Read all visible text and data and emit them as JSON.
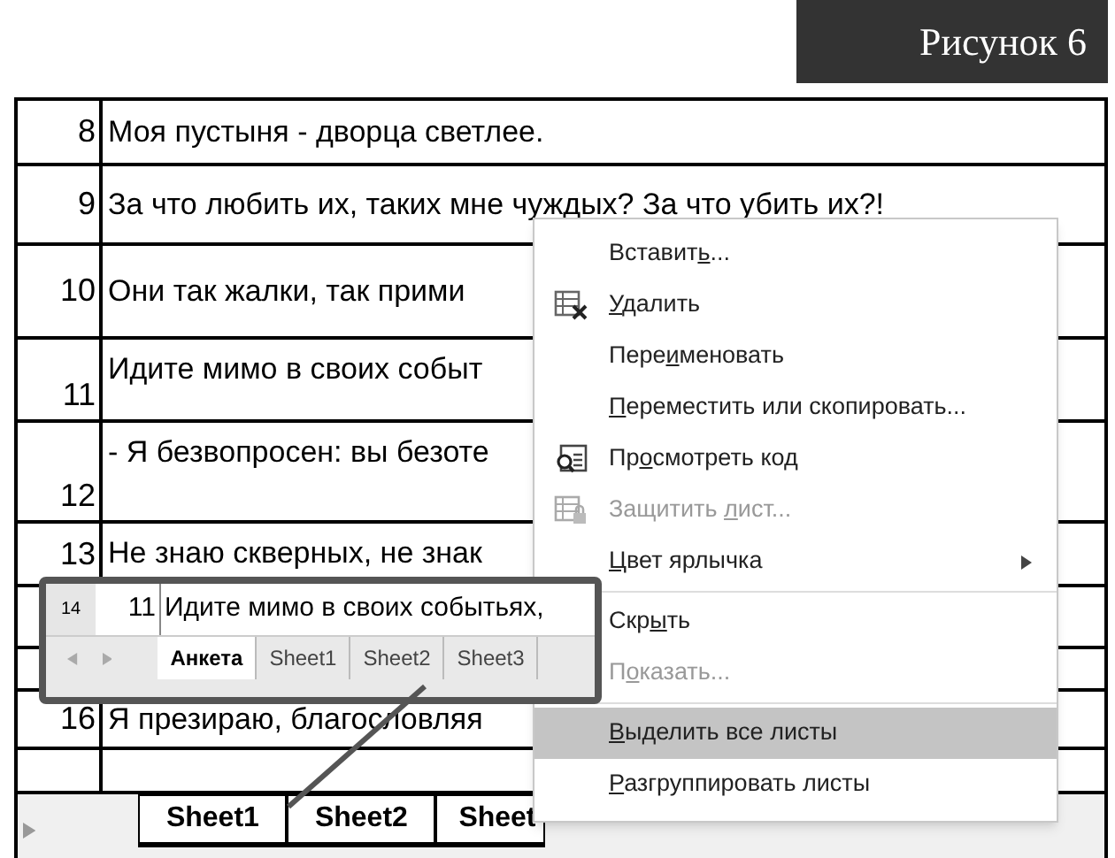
{
  "caption": "Рисунок 6",
  "rows": [
    {
      "number": "8",
      "text": "Моя пустыня - дворца светлее.",
      "kind": "plain"
    },
    {
      "number": "9",
      "text": "За что любить их, таких мне чуждых? За что убить их?!",
      "kind": "plain"
    },
    {
      "number": "10",
      "text": "Они так жалки, так прими",
      "kind": "plain"
    },
    {
      "number": "11",
      "text": "Идите мимо в своих событ",
      "kind": "wrapped"
    },
    {
      "number": "12",
      "text": "- Я безвопросен: вы безоте",
      "kind": "wrapped"
    },
    {
      "number": "13",
      "text": "Не знаю скверных, не знак",
      "kind": "plain"
    },
    {
      "kind": "plain"
    },
    {
      "kind": "plain"
    },
    {
      "number": "16",
      "text": "Я презираю, благословляя",
      "kind": "plain"
    },
    {
      "kind": "plain"
    }
  ],
  "sheet_tabs": [
    {
      "label": "Sheet1",
      "selected": true
    },
    {
      "label": "Sheet2",
      "selected": true
    },
    {
      "label": "Sheet",
      "selected": true
    }
  ],
  "inset": {
    "row_header": "14",
    "number": "11",
    "text": "Идите мимо в своих событьях,",
    "tabs": [
      {
        "label": "Анкета",
        "selected": true
      },
      {
        "label": "Sheet1",
        "selected": false
      },
      {
        "label": "Sheet2",
        "selected": false
      },
      {
        "label": "Sheet3",
        "selected": false
      }
    ]
  },
  "context_menu": [
    {
      "label": [
        {
          "text": "Вставит"
        },
        {
          "text": "ь",
          "underline": true
        },
        {
          "text": "..."
        }
      ],
      "disabled": false,
      "selected": false,
      "submenu": false,
      "divider_above": false
    },
    {
      "label": [
        {
          "text": "У",
          "underline": true
        },
        {
          "text": "далить"
        }
      ],
      "disabled": false,
      "selected": false,
      "submenu": false,
      "divider_above": false
    },
    {
      "label": [
        {
          "text": "Пере"
        },
        {
          "text": "и",
          "underline": true
        },
        {
          "text": "меновать"
        }
      ],
      "disabled": false,
      "selected": false,
      "submenu": false,
      "divider_above": false
    },
    {
      "label": [
        {
          "text": "П",
          "underline": true
        },
        {
          "text": "ереместить или скопировать..."
        }
      ],
      "disabled": false,
      "selected": false,
      "submenu": false,
      "divider_above": false
    },
    {
      "label": [
        {
          "text": "Пр"
        },
        {
          "text": "о",
          "underline": true
        },
        {
          "text": "смотреть код"
        }
      ],
      "disabled": false,
      "selected": false,
      "submenu": false,
      "divider_above": false
    },
    {
      "label": [
        {
          "text": "Защитить "
        },
        {
          "text": "л",
          "underline": true
        },
        {
          "text": "ист..."
        }
      ],
      "disabled": true,
      "selected": false,
      "submenu": false,
      "divider_above": false
    },
    {
      "label": [
        {
          "text": "Ц",
          "underline": true
        },
        {
          "text": "вет ярлычка"
        }
      ],
      "disabled": false,
      "selected": false,
      "submenu": true,
      "divider_above": false
    },
    {
      "label": [
        {
          "text": "Скр"
        },
        {
          "text": "ы",
          "underline": true
        },
        {
          "text": "ть"
        }
      ],
      "disabled": false,
      "selected": false,
      "submenu": false,
      "divider_above": true
    },
    {
      "label": [
        {
          "text": "П"
        },
        {
          "text": "о",
          "underline": true
        },
        {
          "text": "казать..."
        }
      ],
      "disabled": true,
      "selected": false,
      "submenu": false,
      "divider_above": false
    },
    {
      "label": [
        {
          "text": "В",
          "underline": true
        },
        {
          "text": "ыделить все листы"
        }
      ],
      "disabled": false,
      "selected": true,
      "submenu": false,
      "divider_above": true
    },
    {
      "label": [
        {
          "text": "Р",
          "underline": true
        },
        {
          "text": "азгруппировать листы"
        }
      ],
      "disabled": false,
      "selected": false,
      "submenu": false,
      "divider_above": false
    }
  ]
}
